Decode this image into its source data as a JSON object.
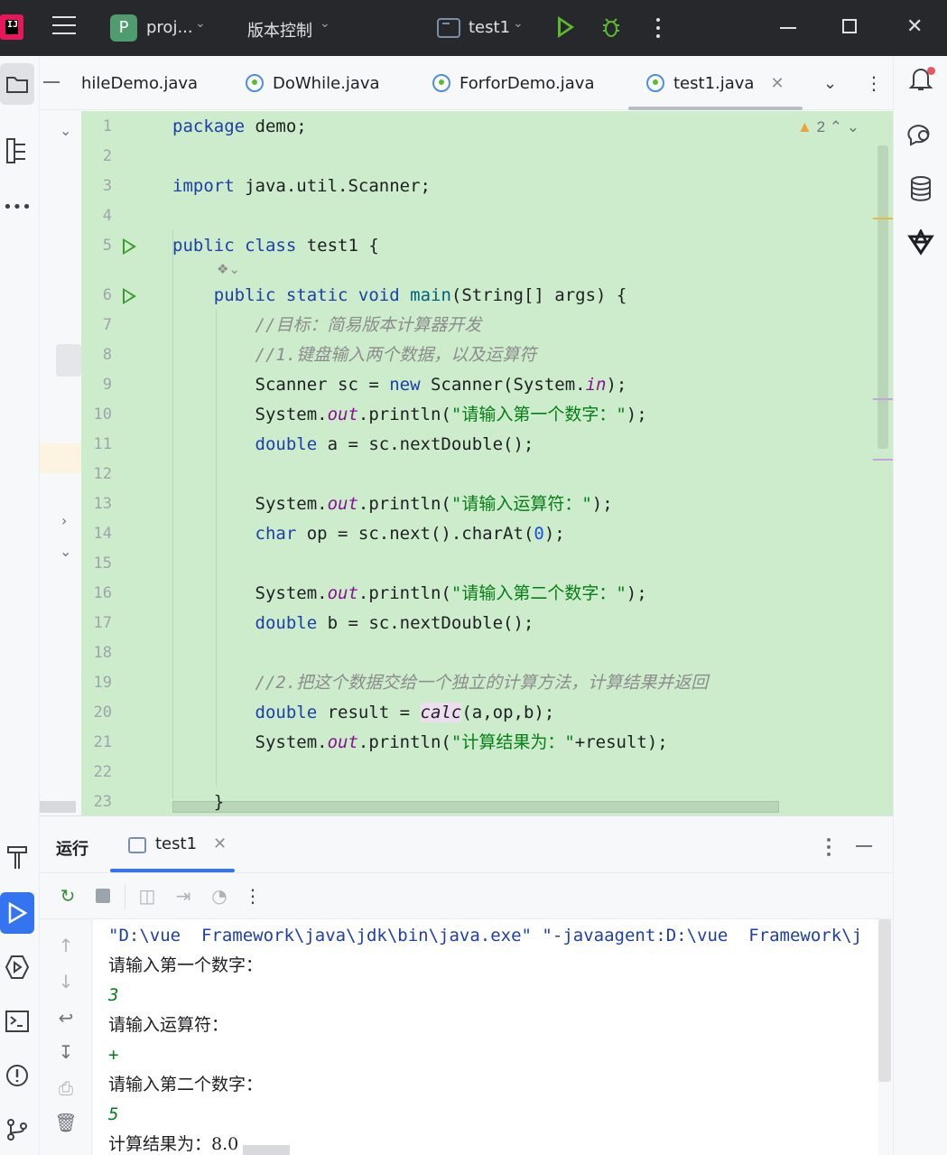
{
  "titlebar": {
    "project_chip": "P",
    "project_name": "proj...",
    "vcs_label": "版本控制",
    "run_config": "test1"
  },
  "tabs": [
    {
      "label": "hileDemo.java"
    },
    {
      "label": "DoWhile.java"
    },
    {
      "label": "ForforDemo.java"
    },
    {
      "label": "test1.java",
      "active": true
    }
  ],
  "editor": {
    "warnings_count": "2",
    "lines": [
      {
        "n": "1",
        "html": "<span class=\"kw\">package</span> demo;"
      },
      {
        "n": "2",
        "html": ""
      },
      {
        "n": "3",
        "html": "<span class=\"kw\">import</span> java.util.Scanner;"
      },
      {
        "n": "4",
        "html": ""
      },
      {
        "n": "5",
        "html": "<span class=\"kw\">public class</span> test1 {",
        "run": true
      },
      {
        "n": "6",
        "html": "    <span class=\"kw\">public static void</span> <span style=\"color:#00627a\">main</span>(String[] args) {",
        "run": true
      },
      {
        "n": "7",
        "html": "        <span class=\"cmt\">//目标：简易版本计算器开发</span>"
      },
      {
        "n": "8",
        "html": "        <span class=\"cmt\">//1.键盘输入两个数据，以及运算符</span>"
      },
      {
        "n": "9",
        "html": "        Scanner sc = <span class=\"kw\">new</span> Scanner(System.<span class=\"fld\">in</span>);"
      },
      {
        "n": "10",
        "html": "        System.<span class=\"fld\">out</span>.println(<span class=\"str\">\"请输入第一个数字：\"</span>);"
      },
      {
        "n": "11",
        "html": "        <span class=\"kw\">double</span> a = sc.nextDouble();"
      },
      {
        "n": "12",
        "html": ""
      },
      {
        "n": "13",
        "html": "        System.<span class=\"fld\">out</span>.println(<span class=\"str\">\"请输入运算符：\"</span>);"
      },
      {
        "n": "14",
        "html": "        <span class=\"kw\">char</span> op = sc.next().charAt(<span class=\"num\">0</span>);"
      },
      {
        "n": "15",
        "html": ""
      },
      {
        "n": "16",
        "html": "        System.<span class=\"fld\">out</span>.println(<span class=\"str\">\"请输入第二个数字：\"</span>);"
      },
      {
        "n": "17",
        "html": "        <span class=\"kw\">double</span> b = sc.nextDouble();"
      },
      {
        "n": "18",
        "html": ""
      },
      {
        "n": "19",
        "html": "        <span class=\"cmt\">//2.把这个数据交给一个独立的计算方法，计算结果并返回</span>"
      },
      {
        "n": "20",
        "html": "        <span class=\"kw\">double</span> result = <span class=\"calc-hl\" style=\"font-style:italic\">calc</span>(a,op,b);"
      },
      {
        "n": "21",
        "html": "        System.<span class=\"fld\">out</span>.println(<span class=\"str\">\"计算结果为：\"</span>+result);"
      },
      {
        "n": "22",
        "html": ""
      },
      {
        "n": "23",
        "html": "    }"
      }
    ]
  },
  "run_panel": {
    "title": "运行",
    "tab_label": "test1",
    "console": [
      {
        "kind": "cmd",
        "text": "\"D:\\vue  Framework\\java\\jdk\\bin\\java.exe\" \"-javaagent:D:\\vue  Framework\\j"
      },
      {
        "kind": "zh",
        "text": "请输入第一个数字："
      },
      {
        "kind": "inp",
        "text": "3"
      },
      {
        "kind": "zh",
        "text": "请输入运算符："
      },
      {
        "kind": "inp",
        "text": "+"
      },
      {
        "kind": "zh",
        "text": "请输入第二个数字："
      },
      {
        "kind": "inp",
        "text": "5"
      },
      {
        "kind": "res",
        "text": "计算结果为：8.0"
      }
    ]
  },
  "colors": {
    "titlebar_bg": "#27282c",
    "editor_bg": "#cdeccc",
    "accent": "#3574f0",
    "run_green": "#5fb832"
  }
}
